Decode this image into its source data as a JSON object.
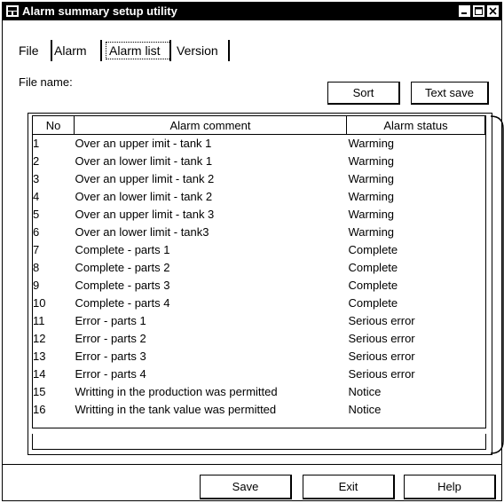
{
  "window": {
    "title": "Alarm summary setup utility"
  },
  "tabs": [
    {
      "label": "File"
    },
    {
      "label": "Alarm"
    },
    {
      "label": "Alarm list"
    },
    {
      "label": "Version"
    }
  ],
  "file_name_label": "File name:",
  "toolbar": {
    "sort_label": "Sort",
    "text_save_label": "Text save"
  },
  "table": {
    "headers": [
      "No",
      "Alarm comment",
      "Alarm status"
    ],
    "rows": [
      [
        "1",
        "Over an upper imit - tank 1",
        "Warming"
      ],
      [
        "2",
        "Over an lower limit - tank 1",
        "Warming"
      ],
      [
        "3",
        "Over an upper limit - tank 2",
        "Warming"
      ],
      [
        "4",
        "Over an lower limit - tank 2",
        "Warming"
      ],
      [
        "5",
        "Over an upper limit - tank 3",
        "Warming"
      ],
      [
        "6",
        "Over an lower limit - tank3",
        "Warming"
      ],
      [
        "7",
        "Complete - parts 1",
        "Complete"
      ],
      [
        "8",
        "Complete - parts 2",
        "Complete"
      ],
      [
        "9",
        "Complete - parts 3",
        "Complete"
      ],
      [
        "10",
        "Complete - parts 4",
        "Complete"
      ],
      [
        "11",
        "Error - parts 1",
        "Serious error"
      ],
      [
        "12",
        "Error - parts 2",
        "Serious error"
      ],
      [
        "13",
        "Error - parts 3",
        "Serious error"
      ],
      [
        "14",
        "Error - parts 4",
        "Serious error"
      ],
      [
        "15",
        "Writting in the production was permitted",
        "Notice"
      ],
      [
        "16",
        "Writting in the tank value was permitted",
        "Notice"
      ]
    ]
  },
  "footer": {
    "save_label": "Save",
    "exit_label": "Exit",
    "help_label": "Help"
  }
}
